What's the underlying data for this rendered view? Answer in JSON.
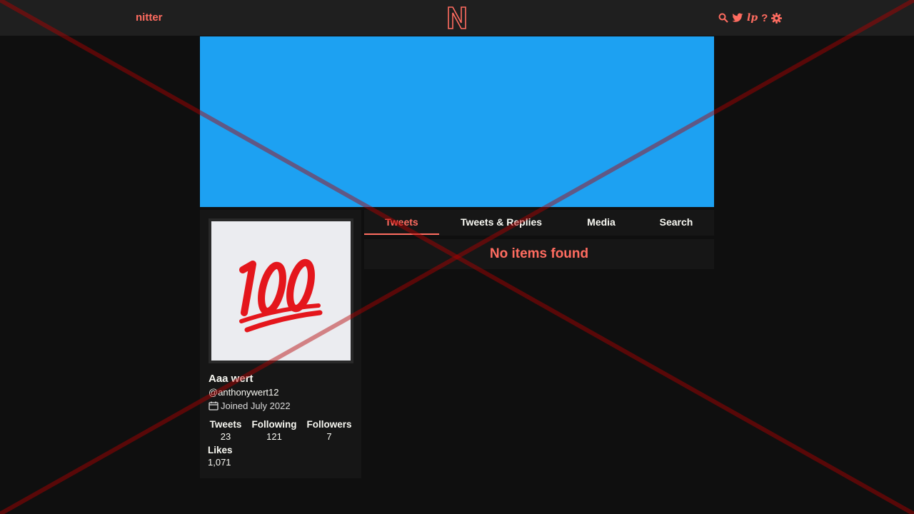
{
  "navbar": {
    "brand": "nitter",
    "icons": [
      "search-icon",
      "twitter-bird-icon",
      "lp-icon",
      "help-icon",
      "gear-icon"
    ],
    "lp_text": "lp",
    "help_text": "?"
  },
  "colors": {
    "accent": "#ff6c60",
    "banner": "#1da1f2",
    "background": "#0f0f0f",
    "panel": "#161616",
    "overlay_cross": "#8b0000"
  },
  "profile": {
    "fullname": "Aaa wert",
    "username": "@anthonywert12",
    "joined": "Joined July 2022",
    "avatar_emoji": "100",
    "stats": {
      "tweets_label": "Tweets",
      "tweets_value": "23",
      "following_label": "Following",
      "following_value": "121",
      "followers_label": "Followers",
      "followers_value": "7",
      "likes_label": "Likes",
      "likes_value": "1,071"
    }
  },
  "tabs": [
    {
      "label": "Tweets",
      "active": true
    },
    {
      "label": "Tweets & Replies",
      "active": false
    },
    {
      "label": "Media",
      "active": false
    },
    {
      "label": "Search",
      "active": false
    }
  ],
  "timeline": {
    "empty_message": "No items found"
  }
}
